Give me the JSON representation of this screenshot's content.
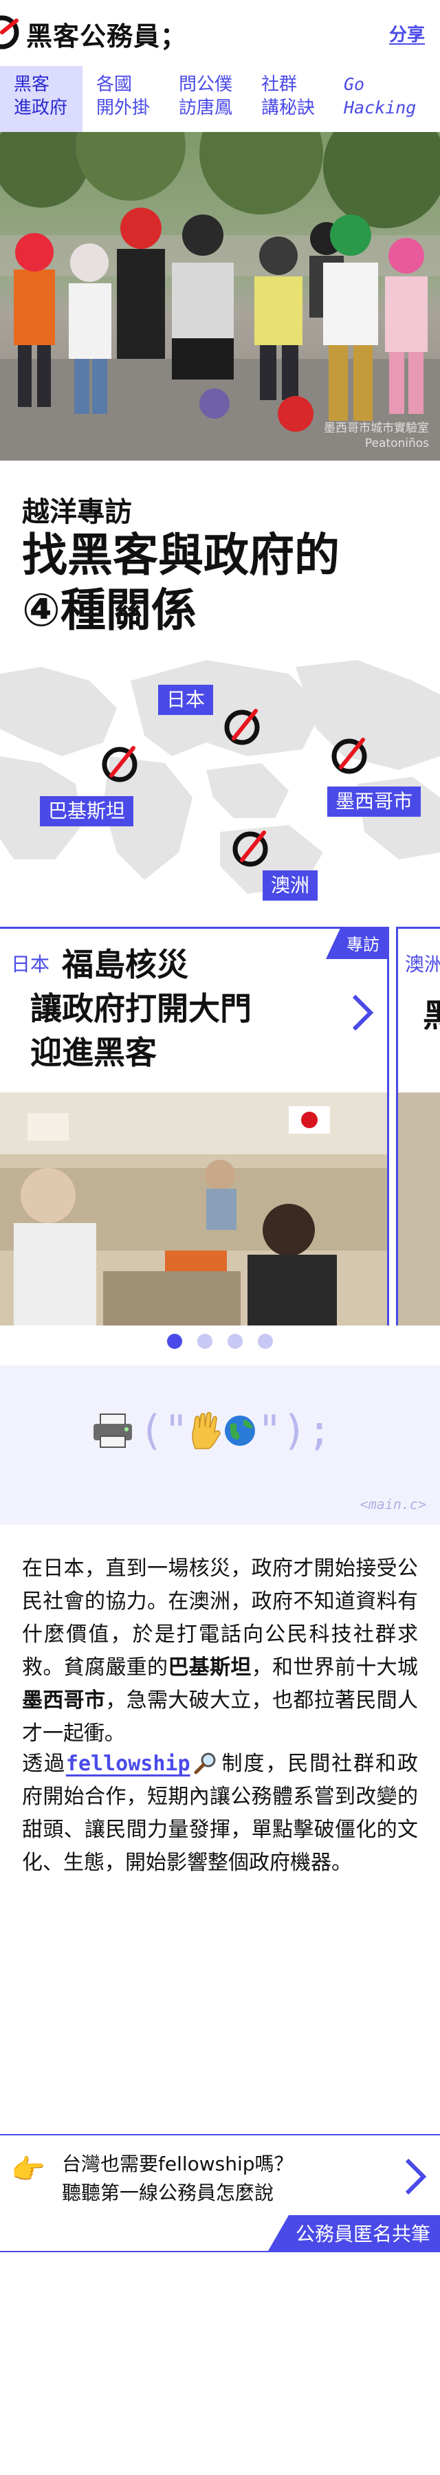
{
  "header": {
    "site_title": "黑客公務員；",
    "share_label": "分享"
  },
  "nav": {
    "items": [
      {
        "line1": "黑客",
        "line2": "進政府",
        "active": true
      },
      {
        "line1": "各國",
        "line2": "開外掛",
        "active": false
      },
      {
        "line1": "問公僕",
        "line2": "訪唐鳳",
        "active": false
      },
      {
        "line1": "社群",
        "line2": "講秘訣",
        "active": false
      },
      {
        "line1": "Go",
        "line2": "Hacking",
        "active": false
      }
    ]
  },
  "hero": {
    "credit_line1": "墨西哥市城市實驗室",
    "credit_line2": "Peatoniños"
  },
  "article": {
    "kicker": "越洋專訪",
    "headline_line1": "找黑客與政府的",
    "headline_line2": "④種關係"
  },
  "map": {
    "labels": {
      "japan": "日本",
      "pakistan": "巴基斯坦",
      "mexico": "墨西哥市",
      "australia": "澳洲"
    },
    "accent": "#4a4ae8",
    "marker_color": "#e8141e"
  },
  "carousel": {
    "card": {
      "badge": "專訪",
      "country": "日本",
      "title_line1": "福島核災",
      "title_line2": "讓政府打開大門",
      "title_line3": "迎進黑客"
    },
    "next_card": {
      "country": "澳洲",
      "title_fragment": "黑"
    },
    "dots": 4,
    "active_dot": 1
  },
  "code_strip": {
    "prefix": "(\"",
    "suffix": "\");",
    "footer": "<main.c>"
  },
  "body": {
    "p1": [
      {
        "t": "在日本，直到一場核災，政府才開始接受公民社會的協力。在澳洲，政府不知道資料有什麼價值，於是打電話向公民科技社群求救。貧腐嚴重的",
        "b": false
      },
      {
        "t": "巴基斯坦",
        "b": true
      },
      {
        "t": "，和世界前十大城",
        "b": false
      },
      {
        "t": "墨西哥市",
        "b": true
      },
      {
        "t": "，急需大破大立，也都拉著民間人才一起衝。",
        "b": false
      }
    ],
    "p2_before": "透過",
    "p2_link": "fellowship",
    "p2_after": "制度，民間社群和政府開始合作，短期內讓公務體系嘗到改變的甜頭、讓民間力量發揮，單點擊破僵化的文化、生態，開始影響整個政府機器。"
  },
  "cta": {
    "line1": "台灣也需要fellowship嗎？",
    "line2": "聽聽第一線公務員怎麼說",
    "tag": "公務員匿名共筆"
  },
  "colors": {
    "accent": "#4a4ae8",
    "nav_active_bg": "#dcdcff",
    "code_bg": "#f2f2ff"
  }
}
